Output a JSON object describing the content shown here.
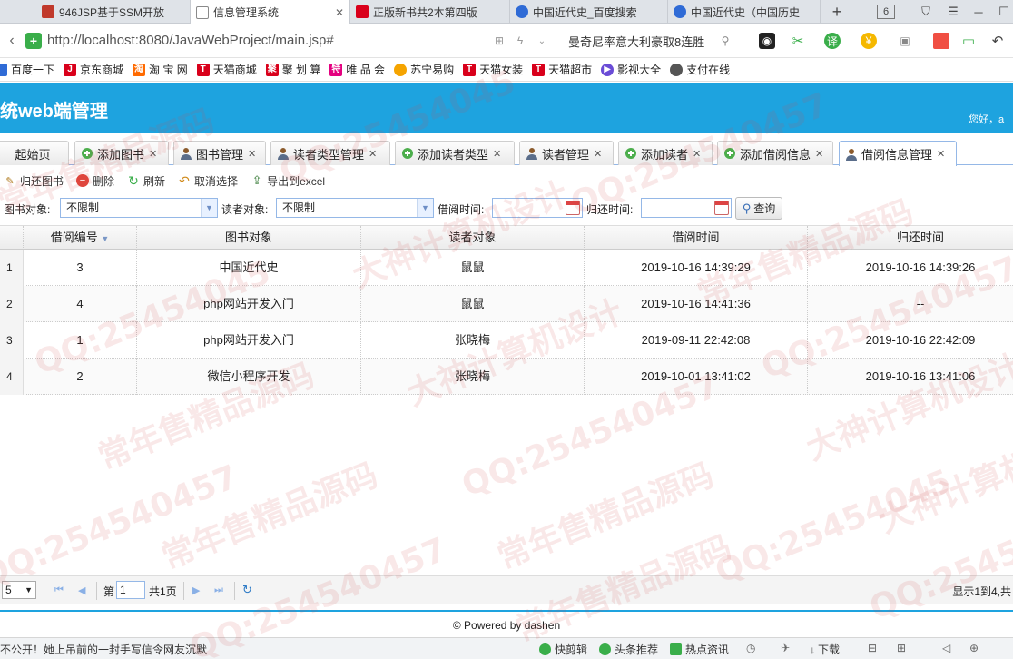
{
  "browser": {
    "tabs": [
      {
        "title": "946JSP基于SSM开放",
        "color": "#c0392b"
      },
      {
        "title": "信息管理系统",
        "color": "#8a8a8a"
      },
      {
        "title": "正版新书共2本第四版",
        "color": "#d9001b"
      },
      {
        "title": "中国近代史_百度搜索",
        "color": "#2f6bd6"
      },
      {
        "title": "中国近代史（中国历史",
        "color": "#2f6bd6"
      }
    ],
    "tab_count": "6",
    "url": "http://localhost:8080/JavaWebProject/main.jsp#",
    "url_host": "localhost",
    "search_text": "曼奇尼率意大利豪取8连胜"
  },
  "bookmarks": [
    {
      "label": "百度一下",
      "color": "#2f6bd6",
      "glyph": "百"
    },
    {
      "label": "京东商城",
      "color": "#d9001b",
      "glyph": "J"
    },
    {
      "label": "淘 宝 网",
      "color": "#ff6a00",
      "glyph": "淘"
    },
    {
      "label": "天猫商城",
      "color": "#d9001b",
      "glyph": "T"
    },
    {
      "label": "聚 划 算",
      "color": "#d9001b",
      "glyph": "聚"
    },
    {
      "label": "唯 品 会",
      "color": "#e4007f",
      "glyph": "特"
    },
    {
      "label": "苏宁易购",
      "color": "#f5a400",
      "glyph": "苏"
    },
    {
      "label": "天猫女装",
      "color": "#d9001b",
      "glyph": "T"
    },
    {
      "label": "天猫超市",
      "color": "#d9001b",
      "glyph": "T"
    },
    {
      "label": "影视大全",
      "color": "#6a4cd6",
      "glyph": "▶"
    },
    {
      "label": "支付在线",
      "color": "#555555",
      "glyph": "支"
    }
  ],
  "app": {
    "title": "统web端管理",
    "greeting": "您好，a |"
  },
  "inner_tabs": [
    {
      "label": "起始页",
      "icon": "none",
      "closable": false
    },
    {
      "label": "添加图书",
      "icon": "add-icon",
      "closable": true
    },
    {
      "label": "图书管理",
      "icon": "user-icon",
      "closable": true
    },
    {
      "label": "读者类型管理",
      "icon": "user-icon",
      "closable": true
    },
    {
      "label": "添加读者类型",
      "icon": "add-icon",
      "closable": true
    },
    {
      "label": "读者管理",
      "icon": "user-icon",
      "closable": true
    },
    {
      "label": "添加读者",
      "icon": "add-icon",
      "closable": true
    },
    {
      "label": "添加借阅信息",
      "icon": "add-icon",
      "closable": true
    },
    {
      "label": "借阅信息管理",
      "icon": "user-icon",
      "closable": true
    }
  ],
  "toolbar": {
    "return_label": "归还图书",
    "delete_label": "删除",
    "refresh_label": "刷新",
    "unselect_label": "取消选择",
    "export_label": "导出到excel"
  },
  "filter": {
    "book_label": "图书对象:",
    "book_value": "不限制",
    "reader_label": "读者对象:",
    "reader_value": "不限制",
    "borrow_time_label": "借阅时间:",
    "return_time_label": "归还时间:",
    "query_label": "查询"
  },
  "table": {
    "columns": [
      "借阅编号",
      "图书对象",
      "读者对象",
      "借阅时间",
      "归还时间"
    ],
    "rows": [
      {
        "rownum": "1",
        "id": "3",
        "book": "中国近代史",
        "reader": "鼠鼠",
        "borrow_time": "2019-10-16 14:39:29",
        "return_time": "2019-10-16 14:39:26"
      },
      {
        "rownum": "2",
        "id": "4",
        "book": "php网站开发入门",
        "reader": "鼠鼠",
        "borrow_time": "2019-10-16 14:41:36",
        "return_time": "--"
      },
      {
        "rownum": "3",
        "id": "1",
        "book": "php网站开发入门",
        "reader": "张晓梅",
        "borrow_time": "2019-09-11 22:42:08",
        "return_time": "2019-10-16 22:42:09"
      },
      {
        "rownum": "4",
        "id": "2",
        "book": "微信小程序开发",
        "reader": "张晓梅",
        "borrow_time": "2019-10-01 13:41:02",
        "return_time": "2019-10-16 13:41:06"
      }
    ]
  },
  "pager": {
    "page_size": "5",
    "page_prefix": "第",
    "page_number": "1",
    "page_total": "共1页",
    "display_info": "显示1到4,共"
  },
  "footer": {
    "text": "© Powered by dashen"
  },
  "statusbar": {
    "news": "不公开！她上吊前的一封手写信令网友沉默",
    "items": [
      "快剪辑",
      "头条推荐",
      "热点资讯",
      "下载"
    ]
  },
  "watermarks": [
    "常年售精品源码",
    "QQ:25454045",
    "大神计算机设计",
    "QQ:254540457",
    "常年售精品源码",
    "QQ:25454045",
    "大神计算机设计",
    "QQ:254540457",
    "常年售精品源码",
    "QQ:254540457",
    "大神计算机设计",
    "QQ:254540457",
    "常年售精品源码"
  ]
}
